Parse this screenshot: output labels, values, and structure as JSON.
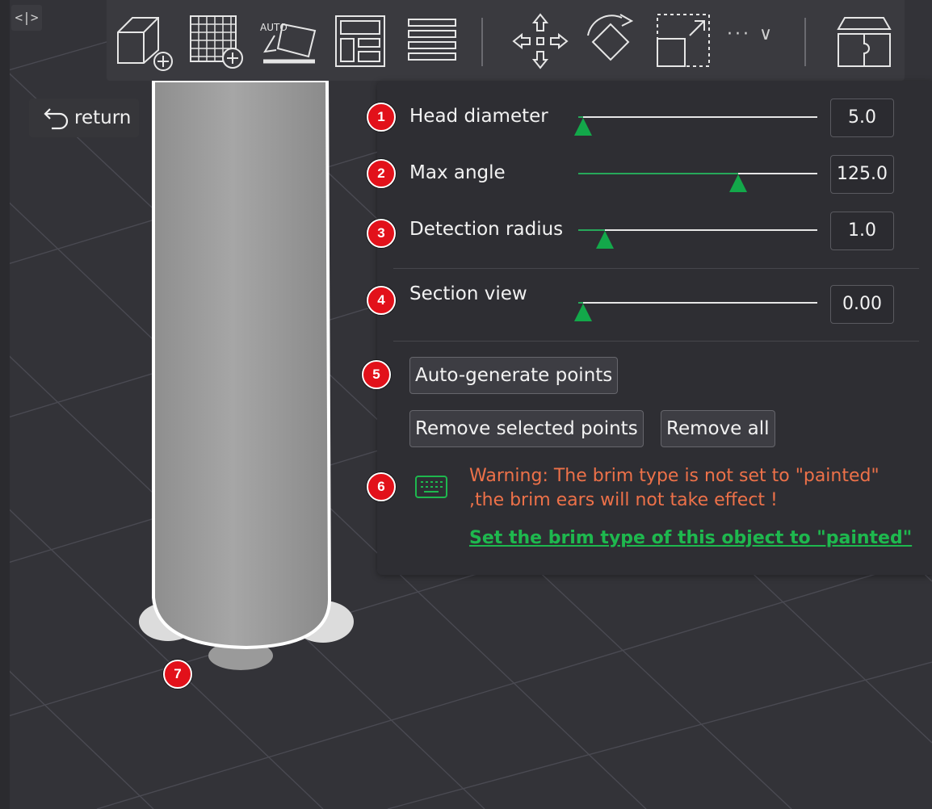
{
  "viewport": {
    "collapse_icon": "code-brackets-icon"
  },
  "toolbar": {
    "items": [
      {
        "name": "add-cube-icon"
      },
      {
        "name": "add-grid-icon"
      },
      {
        "name": "auto-orient-icon",
        "label": "AUTO"
      },
      {
        "name": "arrange-icon"
      },
      {
        "name": "layers-icon"
      },
      {
        "name": "move-icon"
      },
      {
        "name": "rotate-icon"
      },
      {
        "name": "scale-icon"
      },
      {
        "name": "more-icon",
        "label": "··· ∨"
      },
      {
        "name": "split-object-icon"
      }
    ]
  },
  "return_button": {
    "label": "return",
    "icon": "undo-icon"
  },
  "panel": {
    "sliders": [
      {
        "badge": "1",
        "label": "Head diameter",
        "value": "5.0",
        "fraction": 0.02
      },
      {
        "badge": "2",
        "label": "Max angle",
        "value": "125.0",
        "fraction": 0.67
      },
      {
        "badge": "3",
        "label": "Detection radius",
        "value": "1.0",
        "fraction": 0.11
      },
      {
        "badge": "4",
        "label": "Section view",
        "value": "0.00",
        "fraction": 0.02
      }
    ],
    "buttons": {
      "badge": "5",
      "auto_generate": "Auto-generate points",
      "remove_selected": "Remove selected points",
      "remove_all": "Remove all"
    },
    "warning": {
      "badge": "6",
      "icon": "keyboard-icon",
      "line1": "Warning: The brim type is not set to \"painted\"",
      "line2": ",the brim ears will not take effect !",
      "link": "Set the brim type of this object to \"painted\""
    }
  },
  "scene": {
    "badge": "7"
  },
  "colors": {
    "accent_green": "#13a84a",
    "warning_orange": "#ed7149",
    "badge_red": "#e2111a"
  }
}
